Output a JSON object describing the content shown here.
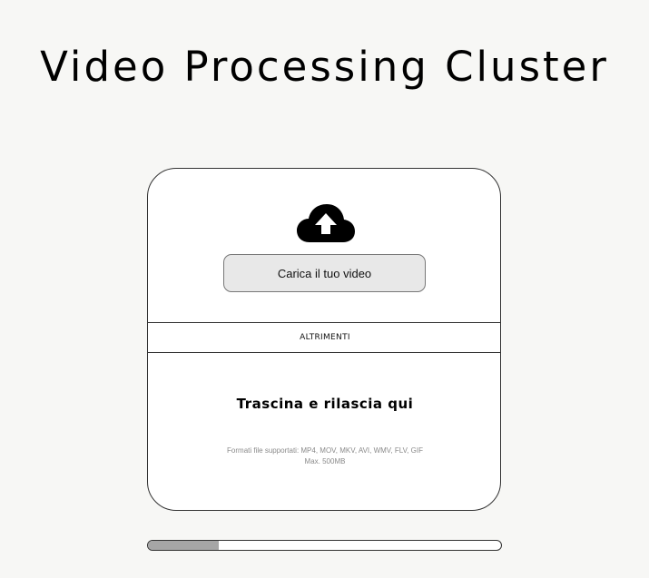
{
  "header": {
    "title": "Video Processing Cluster"
  },
  "upload": {
    "icon": "cloud-upload-icon",
    "button_label": "Carica il tuo video"
  },
  "divider": {
    "label": "ALTRIMENTI"
  },
  "drop_zone": {
    "title": "Trascina e rilascia qui",
    "formats_line": "Formati file supportati: MP4, MOV, MKV, AVI, WMV, FLV, GIF",
    "max_size_line": "Max. 500MB"
  },
  "progress": {
    "value": 0.2
  },
  "colors": {
    "background": "#f7f7f5",
    "button_bg": "#e8e8e8",
    "progress_fill": "#a6a6a6"
  }
}
